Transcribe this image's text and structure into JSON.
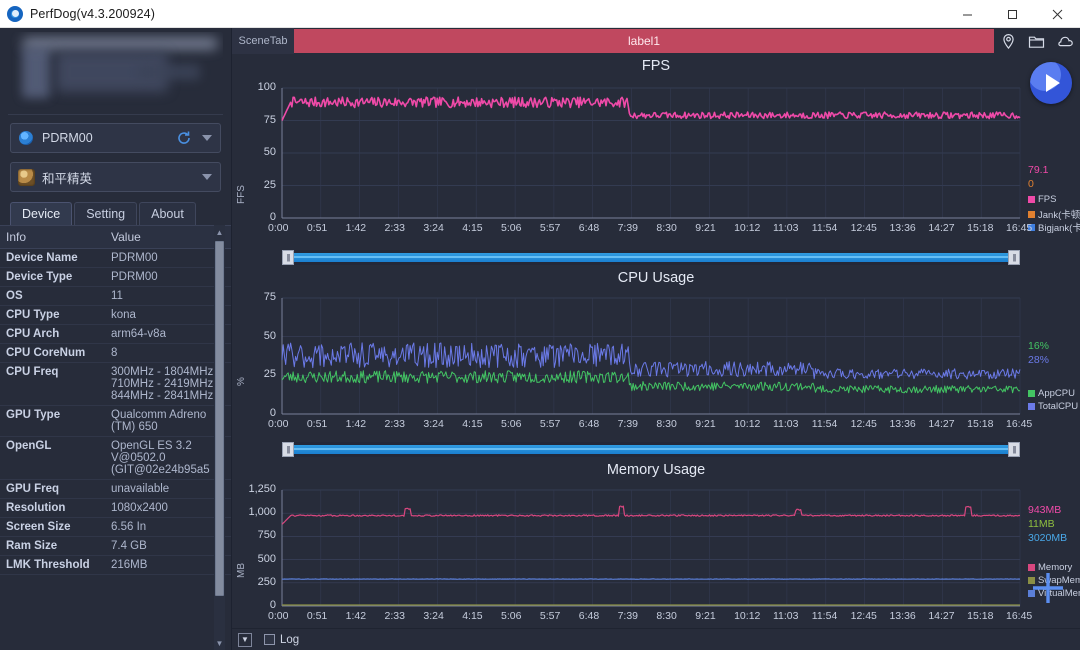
{
  "window": {
    "title": "PerfDog(v4.3.200924)",
    "logo_icon": "perfdog-logo-icon",
    "minimize_label": "Minimize",
    "maximize_label": "Maximize",
    "close_label": "Close"
  },
  "sidebar": {
    "device_combo": {
      "value": "PDRM00",
      "icon": "device-dot-icon",
      "refresh_icon": "refresh-icon",
      "caret_icon": "chevron-down-icon"
    },
    "app_combo": {
      "value": "和平精英",
      "icon": "app-icon",
      "caret_icon": "chevron-down-icon"
    },
    "tabs": [
      {
        "label": "Device",
        "active": true
      },
      {
        "label": "Setting",
        "active": false
      },
      {
        "label": "About",
        "active": false
      }
    ],
    "table": {
      "headers": [
        "Info",
        "Value"
      ],
      "rows": [
        {
          "key": "Device Name",
          "value": "PDRM00"
        },
        {
          "key": "Device Type",
          "value": "PDRM00"
        },
        {
          "key": "OS",
          "value": "11"
        },
        {
          "key": "CPU Type",
          "value": "kona"
        },
        {
          "key": "CPU Arch",
          "value": "arm64-v8a"
        },
        {
          "key": "CPU CoreNum",
          "value": "8"
        },
        {
          "key": "CPU Freq",
          "value": "300MHz - 1804MHz 710MHz - 2419MHz 844MHz - 2841MHz"
        },
        {
          "key": "GPU Type",
          "value": "Qualcomm Adreno (TM) 650"
        },
        {
          "key": "OpenGL",
          "value": "OpenGL ES 3.2 V@0502.0 (GIT@02e24b95a5"
        },
        {
          "key": "GPU Freq",
          "value": "unavailable"
        },
        {
          "key": "Resolution",
          "value": "1080x2400"
        },
        {
          "key": "Screen Size",
          "value": "6.56 In"
        },
        {
          "key": "Ram Size",
          "value": "7.4 GB"
        },
        {
          "key": "LMK Threshold",
          "value": "216MB"
        }
      ]
    }
  },
  "scenebar": {
    "scene_tab_label": "SceneTab",
    "label_band": "label1",
    "icons": [
      "location-pin-icon",
      "folder-icon",
      "cloud-icon"
    ]
  },
  "controls": {
    "play_label": "Start",
    "add_label": "Add",
    "range_left_grip": "|||",
    "range_right_grip": "|||"
  },
  "bottombar": {
    "expand_icon": "expand-down-icon",
    "log_checkbox": false,
    "log_label": "Log"
  },
  "chart_data": [
    {
      "type": "line",
      "title": "FPS",
      "ylabel": "FFS",
      "xlabel": "",
      "ylim": [
        0,
        100
      ],
      "yticks": [
        0,
        25,
        50,
        75,
        100
      ],
      "xticks": [
        "0:00",
        "0:51",
        "1:42",
        "2:33",
        "3:24",
        "4:15",
        "5:06",
        "5:57",
        "6:48",
        "7:39",
        "8:30",
        "9:21",
        "10:12",
        "11:03",
        "11:54",
        "12:45",
        "13:36",
        "14:27",
        "15:18",
        "16:45"
      ],
      "grid": true,
      "legend_position": "right",
      "current_values": [
        {
          "text": "79.1",
          "color": "#ef4aa8"
        },
        {
          "text": "0",
          "color": "#e08030"
        }
      ],
      "series": [
        {
          "name": "FPS",
          "color": "#ef4aa8",
          "segments": [
            {
              "level": 89,
              "noise": 4,
              "from": 0,
              "to": 0.47
            },
            {
              "level": 79,
              "noise": 2.5,
              "from": 0.47,
              "to": 1.0
            }
          ]
        },
        {
          "name": "Jank(卡顿次数)",
          "color": "#e08030",
          "segments": []
        },
        {
          "name": "Bigjank(卡顿次数)",
          "color": "#3f7fe0",
          "segments": []
        }
      ]
    },
    {
      "type": "line",
      "title": "CPU Usage",
      "ylabel": "%",
      "xlabel": "",
      "ylim": [
        0,
        75
      ],
      "yticks": [
        0,
        25,
        50,
        75
      ],
      "xticks": [
        "0:00",
        "0:51",
        "1:42",
        "2:33",
        "3:24",
        "4:15",
        "5:06",
        "5:57",
        "6:48",
        "7:39",
        "8:30",
        "9:21",
        "10:12",
        "11:03",
        "11:54",
        "12:45",
        "13:36",
        "14:27",
        "15:18",
        "16:45"
      ],
      "grid": true,
      "legend_position": "right",
      "current_values": [
        {
          "text": "16%",
          "color": "#43c463"
        },
        {
          "text": "28%",
          "color": "#6b7ae8"
        }
      ],
      "series": [
        {
          "name": "AppCPU",
          "color": "#43c463",
          "segments": [
            {
              "level": 24,
              "noise": 4,
              "from": 0,
              "to": 0.47
            },
            {
              "level": 18,
              "noise": 3,
              "from": 0.47,
              "to": 0.72
            },
            {
              "level": 16,
              "noise": 2.5,
              "from": 0.72,
              "to": 1.0
            }
          ]
        },
        {
          "name": "TotalCPU",
          "color": "#6b7ae8",
          "segments": [
            {
              "level": 38,
              "noise": 8,
              "from": 0,
              "to": 0.47
            },
            {
              "level": 29,
              "noise": 5,
              "from": 0.47,
              "to": 0.72
            },
            {
              "level": 26,
              "noise": 3.5,
              "from": 0.72,
              "to": 1.0
            }
          ]
        }
      ]
    },
    {
      "type": "line",
      "title": "Memory Usage",
      "ylabel": "MB",
      "xlabel": "",
      "ylim": [
        0,
        1250
      ],
      "yticks": [
        0,
        250,
        500,
        750,
        1000,
        1250
      ],
      "ytick_labels": [
        "0",
        "250",
        "500",
        "750",
        "1,000",
        "1,250"
      ],
      "xticks": [
        "0:00",
        "0:51",
        "1:42",
        "2:33",
        "3:24",
        "4:15",
        "5:06",
        "5:57",
        "6:48",
        "7:39",
        "8:30",
        "9:21",
        "10:12",
        "11:03",
        "11:54",
        "12:45",
        "13:36",
        "14:27",
        "15:18",
        "16:45"
      ],
      "grid": true,
      "legend_position": "right",
      "current_values": [
        {
          "text": "943MB",
          "color": "#ef4aa8"
        },
        {
          "text": "11MB",
          "color": "#8fbf3f"
        },
        {
          "text": "3020MB",
          "color": "#49a8e8"
        }
      ],
      "series": [
        {
          "name": "Memory",
          "color": "#d8477f",
          "segments": [
            {
              "level": 975,
              "noise": 8,
              "from": 0,
              "to": 1.0
            }
          ]
        },
        {
          "name": "SwapMemory",
          "color": "#8a8f45",
          "segments": [
            {
              "level": 11,
              "noise": 0,
              "from": 0,
              "to": 1.0
            }
          ]
        },
        {
          "name": "VirtualMemory",
          "color": "#5b7fd8",
          "segments": [
            {
              "level": 290,
              "noise": 2,
              "from": 0,
              "to": 1.0
            }
          ]
        }
      ]
    }
  ]
}
